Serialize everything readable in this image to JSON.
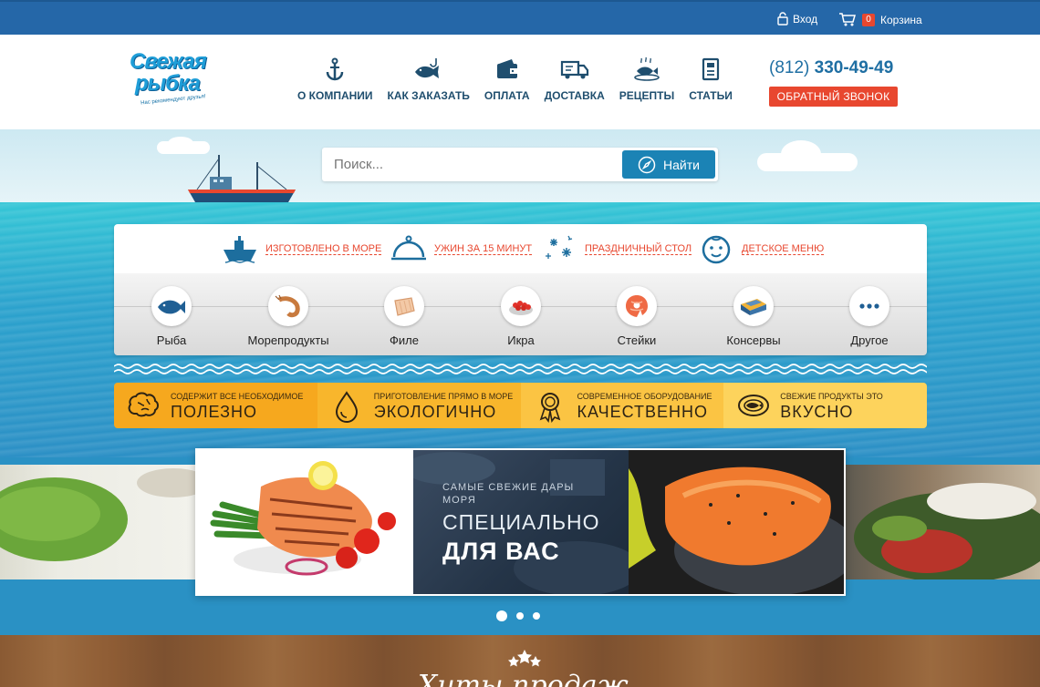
{
  "topbar": {
    "login_label": "Вход",
    "cart_label": "Корзина",
    "cart_count": "0"
  },
  "header": {
    "logo": {
      "line1": "Свежая",
      "line2": "рыбка",
      "tagline": "Нас рекомендуют друзья!"
    },
    "nav": [
      {
        "label": "О КОМПАНИИ",
        "icon": "anchor-icon"
      },
      {
        "label": "КАК ЗАКАЗАТЬ",
        "icon": "fish-hook-icon"
      },
      {
        "label": "ОПЛАТА",
        "icon": "wallet-icon"
      },
      {
        "label": "ДОСТАВКА",
        "icon": "truck-icon"
      },
      {
        "label": "РЕЦЕПТЫ",
        "icon": "fish-dish-icon"
      },
      {
        "label": "СТАТЬИ",
        "icon": "document-icon"
      }
    ],
    "phone_code": "(812)",
    "phone_number": "330-49-49",
    "callback_label": "ОБРАТНЫЙ ЗВОНОК"
  },
  "search": {
    "placeholder": "Поиск...",
    "button_label": "Найти"
  },
  "features": [
    {
      "label": "ИЗГОТОВЛЕНО В МОРЕ",
      "icon": "ship-icon"
    },
    {
      "label": "УЖИН ЗА 15 МИНУТ",
      "icon": "cloche-icon"
    },
    {
      "label": "ПРАЗДНИЧНЫЙ СТОЛ",
      "icon": "fireworks-icon"
    },
    {
      "label": "ДЕТСКОЕ МЕНЮ",
      "icon": "baby-face-icon"
    }
  ],
  "categories": [
    {
      "label": "Рыба",
      "icon": "fish-icon"
    },
    {
      "label": "Морепродукты",
      "icon": "shrimp-icon"
    },
    {
      "label": "Филе",
      "icon": "fillet-icon"
    },
    {
      "label": "Икра",
      "icon": "caviar-icon"
    },
    {
      "label": "Стейки",
      "icon": "steak-icon"
    },
    {
      "label": "Консервы",
      "icon": "canned-fish-icon"
    },
    {
      "label": "Другое",
      "icon": "more-icon"
    }
  ],
  "benefits": [
    {
      "small": "СОДЕРЖИТ ВСЕ НЕОБХОДИМОЕ",
      "big": "ПОЛЕЗНО",
      "icon": "brain-icon",
      "color": "#f6a81e"
    },
    {
      "small": "ПРИГОТОВЛЕНИЕ ПРЯМО В МОРЕ",
      "big": "ЭКОЛОГИЧНО",
      "icon": "drop-icon",
      "color": "#f8b62c"
    },
    {
      "small": "СОВРЕМЕННОЕ ОБОРУДОВАНИЕ",
      "big": "КАЧЕСТВЕННО",
      "icon": "award-icon",
      "color": "#fbc443"
    },
    {
      "small": "СВЕЖИЕ ПРОДУКТЫ ЭТО",
      "big": "ВКУСНО",
      "icon": "dish-icon",
      "color": "#fdd35c"
    }
  ],
  "slider": {
    "caption_small": "САМЫЕ СВЕЖИЕ ДАРЫ МОРЯ",
    "caption_mid": "СПЕЦИАЛЬНО",
    "caption_big": "ДЛЯ ВАС",
    "dots_count": 3,
    "active_dot": 1
  },
  "section_title": "Хиты продаж",
  "colors": {
    "topbar": "#2567a8",
    "accent_red": "#e8472f",
    "brand_blue": "#1f6fa3"
  }
}
